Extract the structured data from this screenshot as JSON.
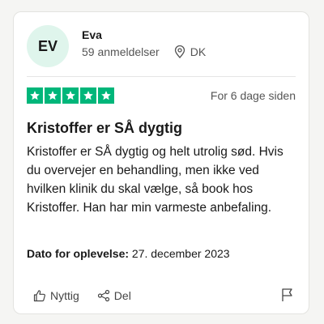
{
  "reviewer": {
    "initials": "EV",
    "name": "Eva",
    "reviews_count": "59 anmeldelser",
    "country": "DK"
  },
  "review": {
    "rating": 5,
    "date_ago": "For 6 dage siden",
    "title": "Kristoffer er SÅ dygtig",
    "body": "Kristoffer er SÅ dygtig og helt utrolig sød. Hvis du overvejer en behandling, men ikke ved hvilken klinik du skal vælge, så book hos Kristoffer. Han har min varmeste anbefaling.",
    "experience_label": "Dato for oplevelse:",
    "experience_date": "27. december 2023"
  },
  "actions": {
    "useful_label": "Nyttig",
    "share_label": "Del"
  },
  "icons": {
    "location": "location-pin-icon",
    "useful": "thumbs-up-icon",
    "share": "share-icon",
    "report": "flag-icon",
    "star": "star-icon"
  },
  "colors": {
    "star_green": "#00b67a",
    "avatar_bg": "#dff5ec"
  }
}
